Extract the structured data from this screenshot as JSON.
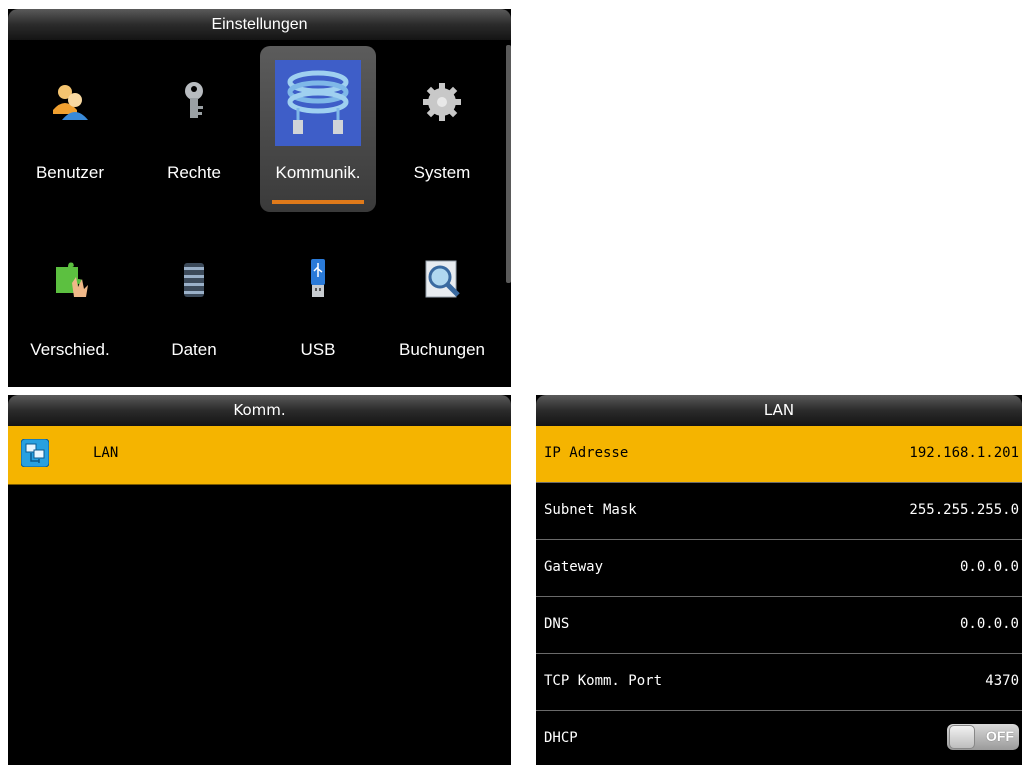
{
  "settings_screen": {
    "title": "Einstellungen",
    "items": [
      {
        "label": "Benutzer",
        "icon": "users-icon"
      },
      {
        "label": "Rechte",
        "icon": "key-icon"
      },
      {
        "label": "Kommunik.",
        "icon": "network-cable-icon",
        "selected": true
      },
      {
        "label": "System",
        "icon": "gear-icon"
      },
      {
        "label": "Verschied.",
        "icon": "puzzle-hand-icon"
      },
      {
        "label": "Daten",
        "icon": "database-icon"
      },
      {
        "label": "USB",
        "icon": "usb-stick-icon"
      },
      {
        "label": "Buchungen",
        "icon": "magnifier-icon"
      }
    ]
  },
  "comm_screen": {
    "title": "Komm.",
    "items": [
      {
        "label": "LAN",
        "icon": "network-computers-icon",
        "selected": true
      }
    ]
  },
  "lan_screen": {
    "title": "LAN",
    "rows": [
      {
        "label": "IP Adresse",
        "value": "192.168.1.201",
        "selected": true
      },
      {
        "label": "Subnet Mask",
        "value": "255.255.255.0"
      },
      {
        "label": "Gateway",
        "value": "0.0.0.0"
      },
      {
        "label": "DNS",
        "value": "0.0.0.0"
      },
      {
        "label": "TCP Komm. Port",
        "value": "4370"
      },
      {
        "label": "DHCP",
        "toggle_text": "OFF",
        "toggle_state": false
      }
    ]
  },
  "colors": {
    "highlight": "#f5b400",
    "selection_bar": "#e07a1a",
    "screen_bg": "#000000"
  }
}
